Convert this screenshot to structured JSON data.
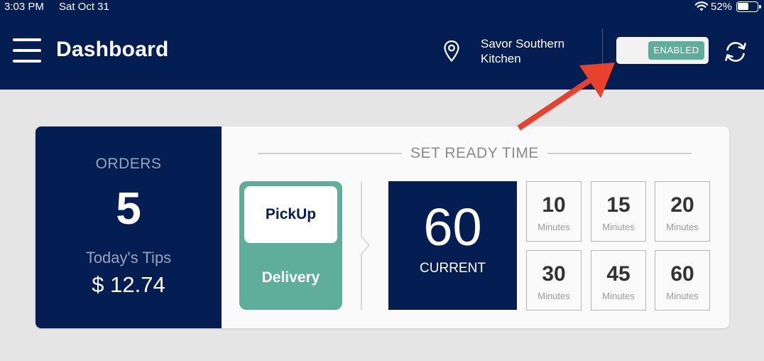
{
  "status_bar": {
    "time": "3:03 PM",
    "date": "Sat Oct 31",
    "battery": "52%"
  },
  "header": {
    "title": "Dashboard",
    "location_name": "Savor Southern Kitchen",
    "toggle_label": "ENABLED"
  },
  "orders": {
    "label": "ORDERS",
    "count": "5",
    "tips_label": "Today's Tips",
    "tips_value": "$ 12.74"
  },
  "ready_time": {
    "title": "SET READY TIME",
    "modes": {
      "pickup": "PickUp",
      "delivery": "Delivery"
    },
    "current_value": "60",
    "current_label": "CURRENT",
    "options": [
      {
        "value": "10",
        "unit": "Minutes"
      },
      {
        "value": "15",
        "unit": "Minutes"
      },
      {
        "value": "20",
        "unit": "Minutes"
      },
      {
        "value": "30",
        "unit": "Minutes"
      },
      {
        "value": "45",
        "unit": "Minutes"
      },
      {
        "value": "60",
        "unit": "Minutes"
      }
    ]
  },
  "colors": {
    "navy": "#041d52",
    "teal": "#5eae9b",
    "background": "#e5e5e5",
    "annotation_arrow": "#e8412e"
  },
  "icons": [
    "wifi-icon",
    "battery-icon",
    "menu-icon",
    "location-pin-icon",
    "refresh-icon",
    "annotation-arrow"
  ]
}
